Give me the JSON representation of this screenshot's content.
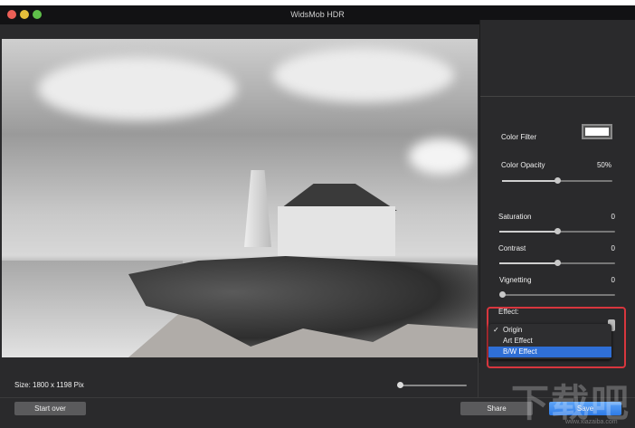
{
  "window": {
    "title": "WidsMob HDR"
  },
  "panel": {
    "color_filter": {
      "label": "Color Filter",
      "color": "#ffffff"
    },
    "color_opacity": {
      "label": "Color Opacity",
      "value": "50%",
      "level": 0.5
    },
    "saturation": {
      "label": "Saturation",
      "value": "0",
      "level": 0.5
    },
    "contrast": {
      "label": "Contrast",
      "value": "0",
      "level": 0.5
    },
    "vignetting": {
      "label": "Vignetting",
      "value": "0",
      "level": 0
    },
    "effect": {
      "label": "Effect:",
      "options": [
        "Origin",
        "Art Effect",
        "B/W Effect"
      ],
      "checked": "Origin",
      "highlighted": "B/W Effect",
      "check_mark": "✓"
    }
  },
  "status": {
    "size": "Size: 1800 x 1198 Pix",
    "zoom_level": 0
  },
  "buttons": {
    "start_over": "Start over",
    "share": "Share",
    "save": "Save"
  },
  "watermark": {
    "text": "下载吧",
    "url": "www.xiazaiba.com"
  },
  "colors": {
    "accent": "#2f6fd6",
    "highlight_border": "#d8363e"
  }
}
